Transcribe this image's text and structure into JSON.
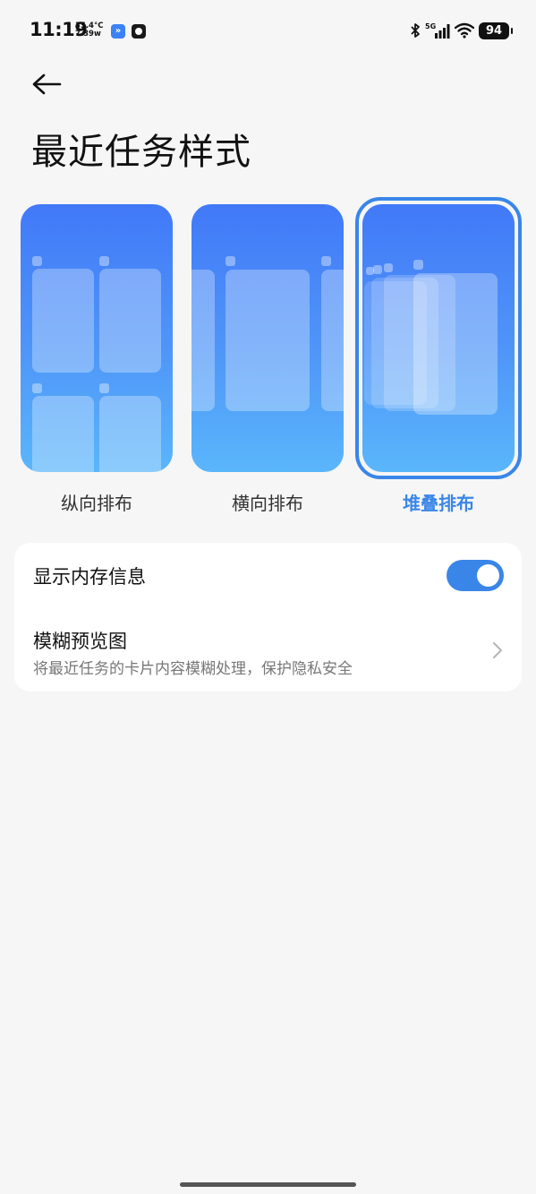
{
  "status_bar": {
    "time": "11:19",
    "temperature": "35.4°C",
    "power": "7.39w",
    "network": "5G",
    "battery": "94"
  },
  "header": {
    "title": "最近任务样式"
  },
  "style_options": [
    {
      "label": "纵向排布",
      "selected": false
    },
    {
      "label": "横向排布",
      "selected": false
    },
    {
      "label": "堆叠排布",
      "selected": true
    }
  ],
  "settings": {
    "show_memory": {
      "label": "显示内存信息",
      "enabled": true
    },
    "blur_preview": {
      "label": "模糊预览图",
      "description": "将最近任务的卡片内容模糊处理，保护隐私安全"
    }
  },
  "colors": {
    "accent": "#3a86e8",
    "background": "#f6f6f6",
    "preview_top": "#4179f8",
    "preview_bottom": "#5ab6fb"
  },
  "icons": {
    "back": "arrow-left-icon",
    "chevron": "chevron-right-icon",
    "bluetooth": "bluetooth-icon",
    "signal": "signal-icon",
    "wifi": "wifi-icon",
    "battery": "battery-icon"
  }
}
